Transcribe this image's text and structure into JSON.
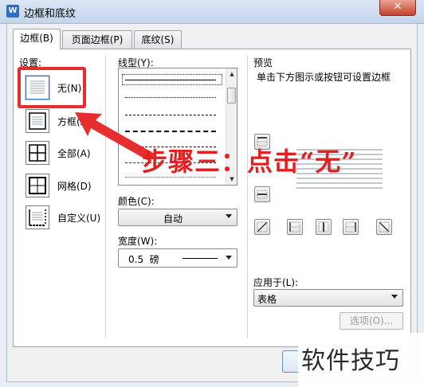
{
  "window": {
    "title": "边框和底纹",
    "icon": "W",
    "close_glyph": "✕"
  },
  "tabs": [
    {
      "label": "边框(B)",
      "active": true
    },
    {
      "label": "页面边框(P)",
      "active": false
    },
    {
      "label": "底纹(S)",
      "active": false
    }
  ],
  "settings": {
    "heading": "设置:",
    "items": [
      {
        "label": "无(N)",
        "icon": "none-border-icon",
        "selected": true
      },
      {
        "label": "方框(X)",
        "icon": "box-border-icon",
        "selected": false
      },
      {
        "label": "全部(A)",
        "icon": "all-borders-icon",
        "selected": false
      },
      {
        "label": "网格(D)",
        "icon": "grid-border-icon",
        "selected": false
      },
      {
        "label": "自定义(U)",
        "icon": "custom-border-icon",
        "selected": false
      }
    ]
  },
  "line_style": {
    "heading": "线型(Y):",
    "options": [
      "solid",
      "dotted",
      "dashed-small",
      "dashed",
      "dash-dot",
      "dash-dot-dot",
      "dotted-fine"
    ],
    "selected_index": 0
  },
  "color": {
    "heading": "颜色(C):",
    "value": "自动"
  },
  "width": {
    "heading": "宽度(W):",
    "value": "0.5  磅"
  },
  "preview": {
    "heading": "预览",
    "hint": "单击下方图示或按钮可设置边框",
    "buttons": [
      "top-border-icon",
      "middle-horizontal-border-icon",
      "bottom-border-icon",
      "diagonal-up-icon",
      "left-border-icon",
      "middle-vertical-border-icon",
      "right-border-icon",
      "diagonal-down-icon"
    ]
  },
  "apply_to": {
    "heading": "应用于(L):",
    "value": "表格"
  },
  "options_button": "选项(O)...",
  "annotation": {
    "text": "步骤三：点击“无”",
    "color": "#e31f1f"
  },
  "watermark": "软件技巧"
}
